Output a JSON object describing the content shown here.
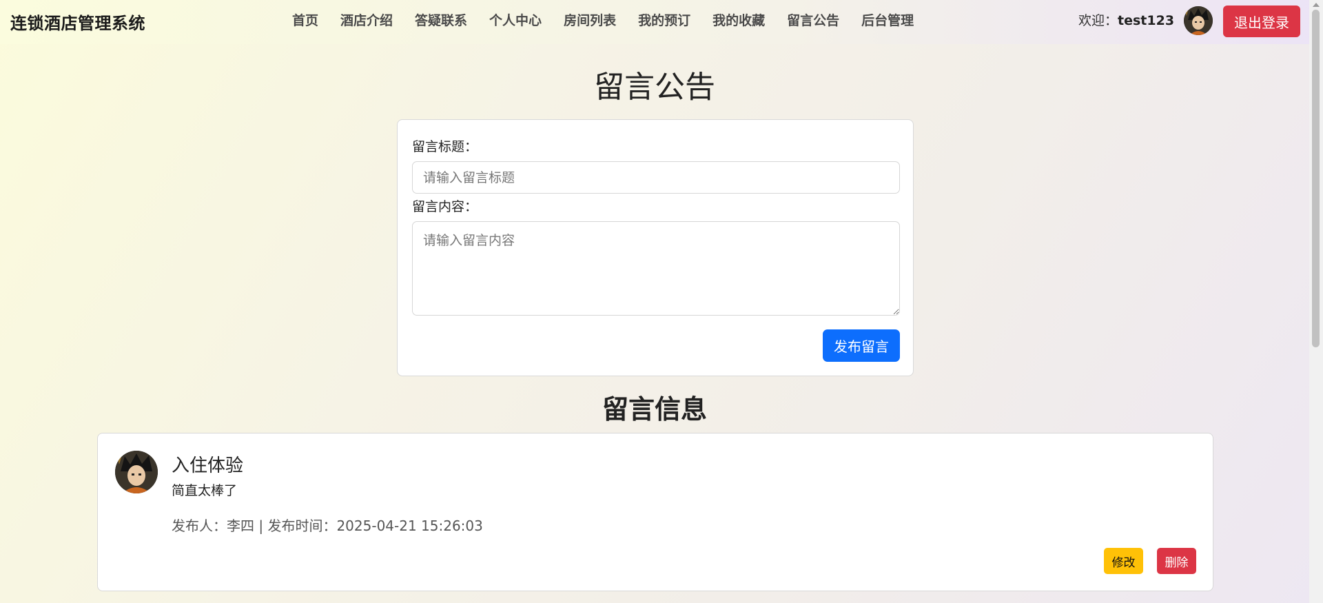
{
  "navbar": {
    "brand": "连锁酒店管理系统",
    "links": [
      {
        "label": "首页"
      },
      {
        "label": "酒店介绍"
      },
      {
        "label": "答疑联系"
      },
      {
        "label": "个人中心"
      },
      {
        "label": "房间列表"
      },
      {
        "label": "我的预订"
      },
      {
        "label": "我的收藏"
      },
      {
        "label": "留言公告"
      },
      {
        "label": "后台管理"
      }
    ],
    "welcome_prefix": "欢迎：",
    "username": "test123",
    "logout_label": "退出登录"
  },
  "page": {
    "title": "留言公告"
  },
  "form": {
    "title_label": "留言标题：",
    "title_placeholder": "请输入留言标题",
    "title_value": "",
    "content_label": "留言内容：",
    "content_placeholder": "请输入留言内容",
    "content_value": "",
    "submit_label": "发布留言"
  },
  "messages_section": {
    "title": "留言信息",
    "items": [
      {
        "title": "入住体验",
        "content": "简直太棒了",
        "meta": "发布人：李四 | 发布时间：2025-04-21 15:26:03",
        "edit_label": "修改",
        "delete_label": "删除"
      }
    ]
  },
  "colors": {
    "primary": "#0d6efd",
    "danger": "#dc3545",
    "warning": "#ffc107"
  }
}
